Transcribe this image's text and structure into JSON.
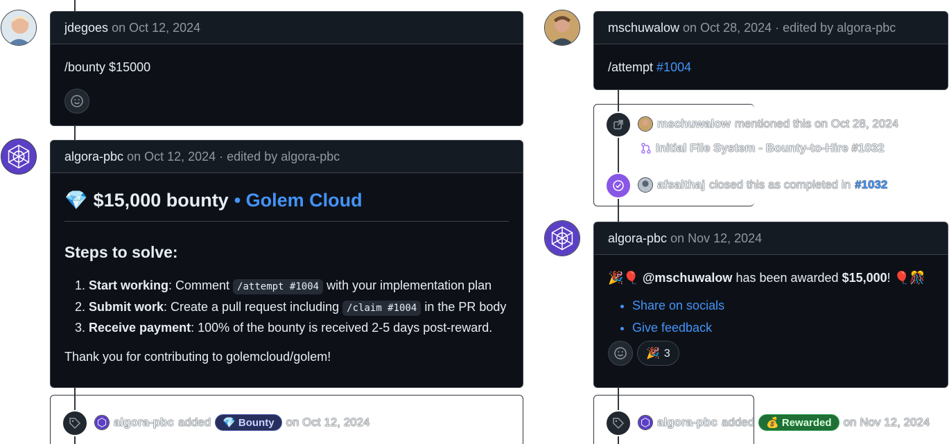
{
  "left": {
    "comment1": {
      "author": "jdegoes",
      "meta": "on Oct 12, 2024",
      "body": "/bounty $15000"
    },
    "comment2": {
      "author": "algora-pbc",
      "meta": "on Oct 12, 2024 · edited by algora-pbc",
      "title_emoji": "💎",
      "title_amount": "$15,000 bounty",
      "title_link": "• Golem Cloud",
      "steps_heading": "Steps to solve:",
      "steps": [
        {
          "bold": "Start working",
          "pre": ": Comment ",
          "code": "/attempt #1004",
          "post": " with your implementation plan"
        },
        {
          "bold": "Submit work",
          "pre": ": Create a pull request including ",
          "code": "/claim #1004",
          "post": " in the PR body"
        },
        {
          "bold": "Receive payment",
          "pre": ": 100% of the bounty is received 2-5 days post-reward.",
          "code": "",
          "post": ""
        }
      ],
      "thanks": "Thank you for contributing to golemcloud/golem!"
    },
    "label_event": {
      "actor": "algora-pbc",
      "action": "added",
      "label_emoji": "💎",
      "label_text": "Bounty",
      "date": "on Oct 12, 2024"
    }
  },
  "right": {
    "comment1": {
      "author": "mschuwalow",
      "meta": "on Oct 28, 2024 · edited by algora-pbc",
      "body_prefix": "/attempt",
      "body_link": "#1004"
    },
    "mention_event": {
      "actor": "mschuwalow",
      "text": "mentioned this on Oct 28, 2024",
      "pr_title": "Initial File System - Bounty-to-Hire #1032"
    },
    "closed_event": {
      "actor": "afsalthaj",
      "text": "closed this as completed in",
      "pr_link": "#1032"
    },
    "comment2": {
      "author": "algora-pbc",
      "meta": "on Nov 12, 2024",
      "emoji_left": "🎉🎈",
      "mention": "@mschuwalow",
      "middle": "has been awarded",
      "amount": "$15,000",
      "bang": "!",
      "emoji_right": "🎈🎊",
      "links": [
        "Share on socials",
        "Give feedback"
      ],
      "reaction_emoji": "🎉",
      "reaction_count": "3"
    },
    "label_event": {
      "actor": "algora-pbc",
      "action": "added",
      "label_emoji": "💰",
      "label_text": "Rewarded",
      "date": "on Nov 12, 2024"
    }
  }
}
